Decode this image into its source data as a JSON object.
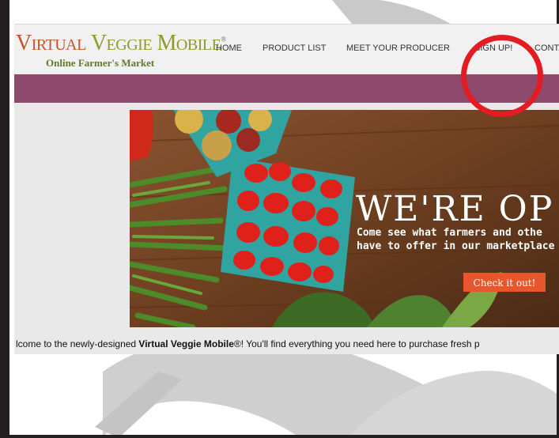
{
  "logo": {
    "main_part1": "Virtual",
    "main_part2": " Veggie Mobile",
    "reg": "®",
    "subtitle": "Online Farmer's Market"
  },
  "nav": {
    "items": [
      "HOME",
      "PRODUCT LIST",
      "MEET YOUR PRODUCER",
      "SIGN UP!",
      "CONTA"
    ]
  },
  "hero": {
    "title": "WE'RE OP",
    "line1": "Come see what farmers and othe",
    "line2": "have to offer in our marketplace",
    "cta": "Check it out!"
  },
  "welcome": {
    "prefix": "lcome to the newly-designed ",
    "brand": "Virtual Veggie Mobile",
    "suffix": "®! You'll find everything you need here to purchase fresh p"
  },
  "colors": {
    "banner": "#8d4a6d",
    "cta": "#e8572c",
    "highlight_circle": "#e31c24"
  }
}
